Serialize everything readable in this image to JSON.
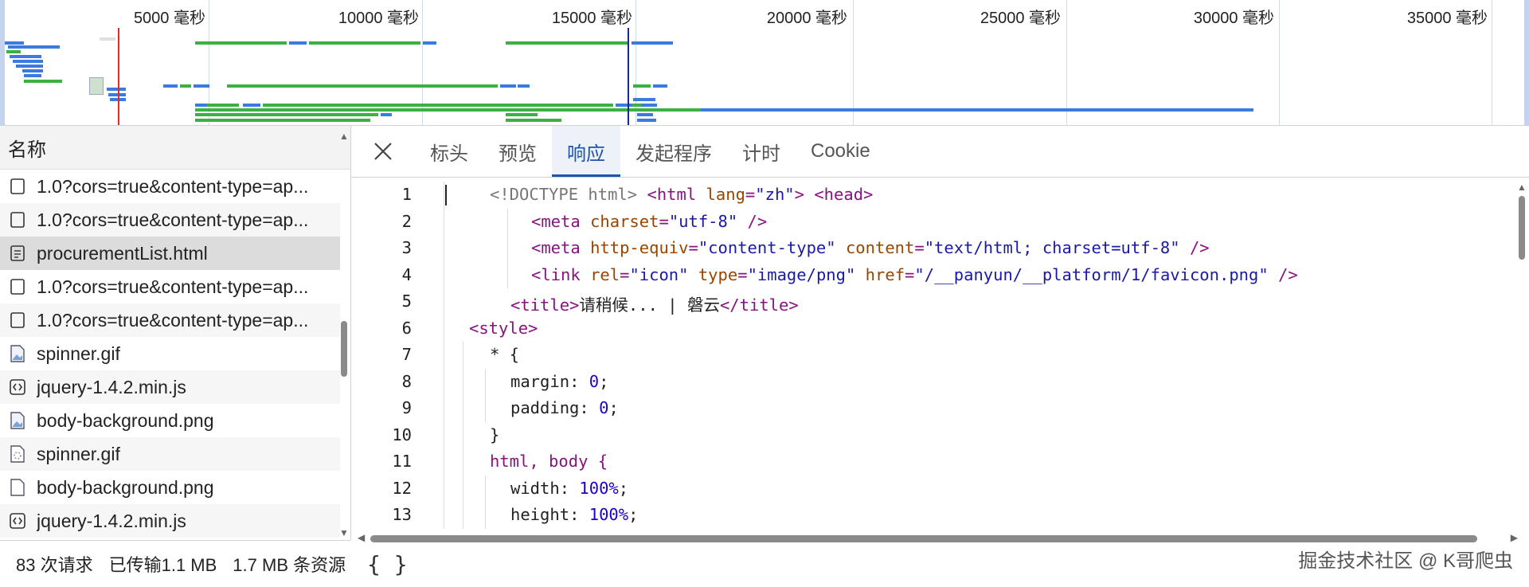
{
  "overview": {
    "tick_labels": [
      "5000 毫秒",
      "10000 毫秒",
      "15000 毫秒",
      "20000 毫秒",
      "25000 毫秒",
      "30000 毫秒",
      "35000 毫秒"
    ]
  },
  "request_list": {
    "header": "名称",
    "rows": [
      {
        "name": "1.0?cors=true&content-type=ap...",
        "icon": "checkbox-icon"
      },
      {
        "name": "1.0?cors=true&content-type=ap...",
        "icon": "checkbox-icon"
      },
      {
        "name": "procurementList.html",
        "icon": "document-icon"
      },
      {
        "name": "1.0?cors=true&content-type=ap...",
        "icon": "checkbox-icon"
      },
      {
        "name": "1.0?cors=true&content-type=ap...",
        "icon": "checkbox-icon"
      },
      {
        "name": "spinner.gif",
        "icon": "image-icon"
      },
      {
        "name": "jquery-1.4.2.min.js",
        "icon": "script-icon"
      },
      {
        "name": "body-background.png",
        "icon": "image-icon"
      },
      {
        "name": "spinner.gif",
        "icon": "spinner-image-icon"
      },
      {
        "name": "body-background.png",
        "icon": "file-icon"
      },
      {
        "name": "jquery-1.4.2.min.js",
        "icon": "script-icon"
      }
    ]
  },
  "status_bar": {
    "requests": "83 次请求",
    "transferred": "已传输1.1 MB",
    "resources": "1.7 MB 条资源"
  },
  "detail": {
    "tabs": [
      "标头",
      "预览",
      "响应",
      "发起程序",
      "计时",
      "Cookie"
    ],
    "active_tab": "响应",
    "pretty_print": "{ }"
  },
  "code": {
    "line_numbers": [
      "1",
      "2",
      "3",
      "4",
      "5",
      "6",
      "7",
      "8",
      "9",
      "10",
      "11",
      "12",
      "13"
    ],
    "l1": {
      "doctype": "<!DOCTYPE html>",
      "html_open": "<html",
      "lang_attr": "lang",
      "lang_val": "\"zh\"",
      "close": ">",
      "head": "<head>"
    },
    "l2": {
      "tag": "<meta",
      "attr": "charset",
      "val": "\"utf-8\"",
      "end": " />"
    },
    "l3": {
      "tag": "<meta",
      "attr1": "http-equiv",
      "val1": "\"content-type\"",
      "attr2": "content",
      "val2": "\"text/html; charset=utf-8\"",
      "end": " />"
    },
    "l4": {
      "tag": "<link",
      "attr1": "rel",
      "val1": "\"icon\"",
      "attr2": "type",
      "val2": "\"image/png\"",
      "attr3": "href",
      "val3": "\"/__panyun/__platform/1/favicon.png\"",
      "end": " />"
    },
    "l5": {
      "open": "<title>",
      "text": "请稍候... | 磐云",
      "close": "</title>"
    },
    "l6": {
      "tag": "<style>"
    },
    "l7": {
      "text": "* {"
    },
    "l8": {
      "prop": "margin",
      "val": "0"
    },
    "l9": {
      "prop": "padding",
      "val": "0"
    },
    "l10": {
      "text": "}"
    },
    "l11": {
      "text": "html, body {"
    },
    "l12": {
      "prop": "width",
      "val": "100%"
    },
    "l13": {
      "prop": "height",
      "val": "100%"
    }
  },
  "watermark": "掘金技术社区 @ K哥爬虫"
}
